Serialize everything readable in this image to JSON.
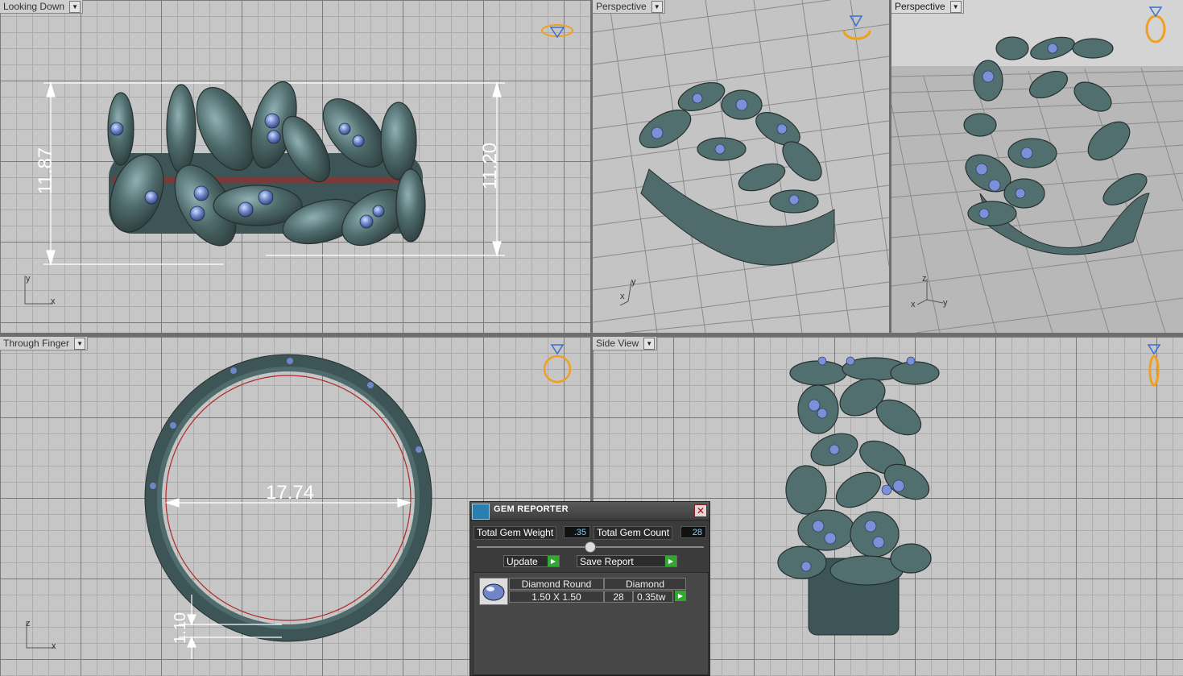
{
  "viewports": {
    "looking_down": {
      "label": "Looking Down",
      "dims": {
        "height_left": "11.87",
        "height_right": "11.20"
      },
      "axes": {
        "v": "y",
        "h": "x"
      }
    },
    "perspective1": {
      "label": "Perspective",
      "axes": {
        "v": "y",
        "h": "x"
      }
    },
    "perspective2": {
      "label": "Perspective",
      "axes": {
        "v": "z",
        "h1": "x",
        "h2": "y"
      }
    },
    "through_finger": {
      "label": "Through Finger",
      "dims": {
        "inner_diameter": "17.74",
        "thickness": "1.10"
      },
      "axes": {
        "v": "z",
        "h": "x"
      }
    },
    "side_view": {
      "label": "Side View"
    }
  },
  "gem_reporter": {
    "title": "GEM REPORTER",
    "total_weight_label": "Total Gem Weight",
    "total_weight_value": ".35",
    "total_count_label": "Total Gem Count",
    "total_count_value": "28",
    "update_label": "Update",
    "save_report_label": "Save Report",
    "rows": [
      {
        "type": "Diamond Round",
        "size": "1.50 X 1.50",
        "material": "Diamond",
        "count": "28",
        "weight": "0.35tw"
      }
    ]
  },
  "colors": {
    "metal": "#4f6b6c",
    "gem": "#6f86c8",
    "viewport_bg": "#c6c6c6",
    "gizmo": "#f0a020"
  },
  "icons": [
    "diamond-gizmo-icon",
    "close-icon",
    "dropdown-arrow-icon",
    "go-arrow-icon",
    "gem-icon"
  ]
}
